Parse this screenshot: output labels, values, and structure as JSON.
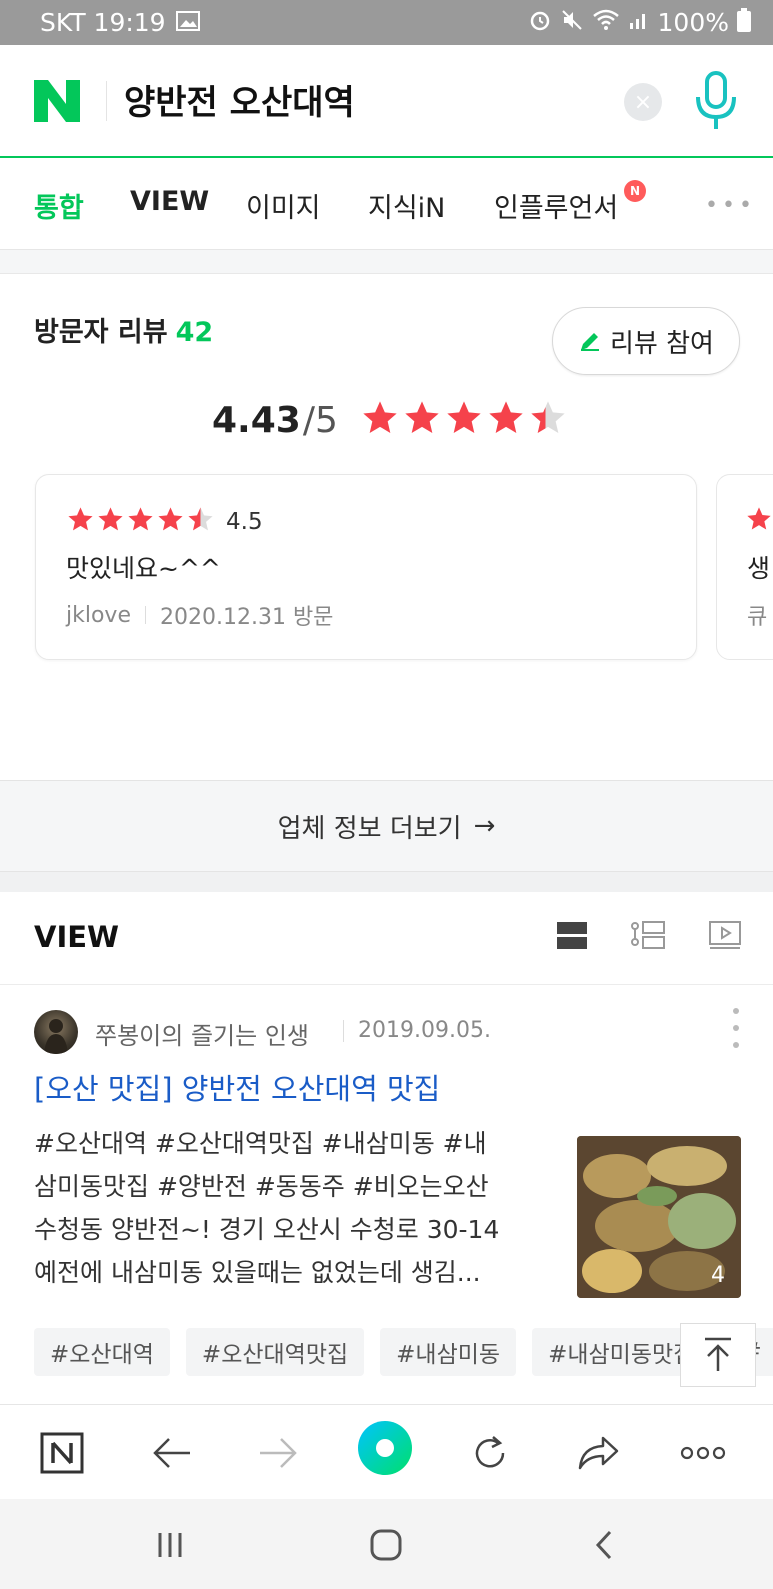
{
  "status_bar": {
    "carrier_time": "SKT 19:19",
    "battery": "100%"
  },
  "search": {
    "logo_letter": "N",
    "query": "양반전 오산대역",
    "clear_label": "×"
  },
  "tabs": [
    {
      "label": "통합",
      "active": true
    },
    {
      "label": "VIEW"
    },
    {
      "label": "이미지"
    },
    {
      "label": "지식iN"
    },
    {
      "label": "인플루언서"
    }
  ],
  "tab_badge": "N",
  "tab_more": "•••",
  "reviews": {
    "title": "방문자 리뷰",
    "count": "42",
    "join_button": "리뷰 참여",
    "rating": "4.43",
    "rating_max": "/5",
    "rating_value": 4.43,
    "cards": [
      {
        "stars_value": 4.5,
        "score": "4.5",
        "text": "맛있네요~^^",
        "user": "jklove",
        "date": "2020.12.31 방문"
      },
      {
        "text": "생",
        "user": "큐"
      }
    ]
  },
  "more_info": {
    "label": "업체 정보 더보기",
    "arrow": "→"
  },
  "view": {
    "title": "VIEW",
    "post": {
      "author": "쭈봉이의 즐기는 인생",
      "date": "2019.09.05.",
      "title": "[오산 맛집] 양반전 오산대역 맛집",
      "body_lines": [
        "#오산대역 #오산대역맛집 #내삼미동 #내",
        "삼미동맛집 #양반전 #동동주 #비오는오산",
        "수청동 양반전~! 경기 오산시 수청로 30-14",
        "예전에 내삼미동 있을때는 없었는데 생김..."
      ],
      "thumb_count": "4",
      "tags": [
        "#오산대역",
        "#오산대역맛집",
        "#내삼미동",
        "#내삼미동맛집",
        "#"
      ]
    }
  },
  "colors": {
    "naver_green": "#03c75a",
    "star_red": "#f5424b",
    "link_blue": "#1a5cc7"
  }
}
